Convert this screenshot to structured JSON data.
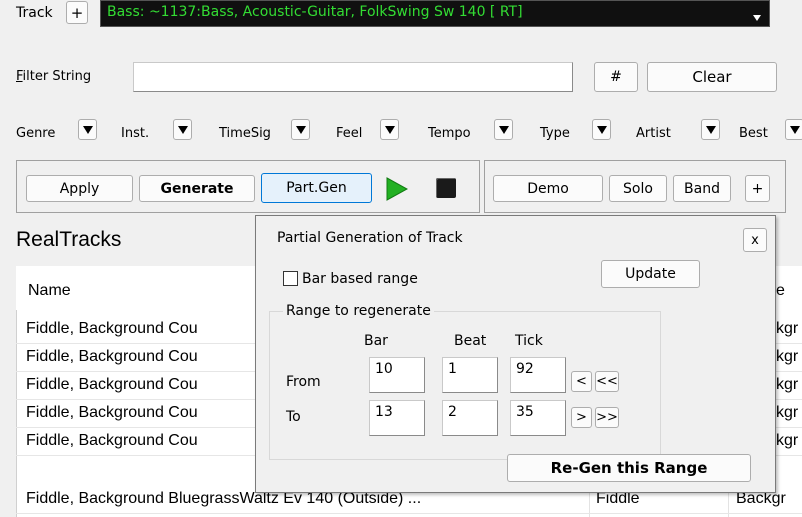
{
  "track": {
    "label": "Track",
    "add_label": "+",
    "selected": "Bass: ~1137:Bass, Acoustic-Guitar, FolkSwing Sw 140 [ RT]"
  },
  "filter": {
    "label": "Filter String",
    "value": "",
    "hash_label": "#",
    "clear_label": "Clear"
  },
  "filters": [
    "Genre",
    "Inst.",
    "TimeSig",
    "Feel",
    "Tempo",
    "Type",
    "Artist",
    "Best"
  ],
  "toolbar": {
    "apply_label": "Apply",
    "generate_label": "Generate",
    "partgen_label": "Part.Gen",
    "demo_label": "Demo",
    "solo_label": "Solo",
    "band_label": "Band",
    "plus_label": "+"
  },
  "section_title": "RealTracks",
  "table": {
    "columns": [
      "Name",
      "",
      "e"
    ],
    "rows": [
      {
        "name": "Fiddle, Background Cou",
        "inst": "",
        "type": "kgr"
      },
      {
        "name": "Fiddle, Background Cou",
        "inst": "",
        "type": "kgr"
      },
      {
        "name": "Fiddle, Background Cou",
        "inst": "",
        "type": "kgr"
      },
      {
        "name": "Fiddle, Background Cou",
        "inst": "",
        "type": "kgr"
      },
      {
        "name": "Fiddle, Background Cou",
        "inst": "",
        "type": "kgr"
      },
      {
        "name": "Fiddle, Background BluegrassWaltz Ev 140 (Outside) ...",
        "inst": "Fiddle",
        "type": "Backgr"
      }
    ]
  },
  "popup": {
    "title": "Partial Generation of Track",
    "close_label": "x",
    "bar_based_label": "Bar based range",
    "update_label": "Update",
    "group_label": "Range to regenerate",
    "col_bar": "Bar",
    "col_beat": "Beat",
    "col_tick": "Tick",
    "from_label": "From",
    "to_label": "To",
    "from": {
      "bar": "10",
      "beat": "1",
      "tick": "92"
    },
    "to": {
      "bar": "13",
      "beat": "2",
      "tick": "35"
    },
    "prev_label": "<",
    "first_label": "<<",
    "next_label": ">",
    "last_label": ">>",
    "regen_label": "Re-Gen this Range"
  },
  "colors": {
    "combo_bg": "#101010",
    "combo_text": "#33dd33",
    "play_green": "#22b022"
  }
}
